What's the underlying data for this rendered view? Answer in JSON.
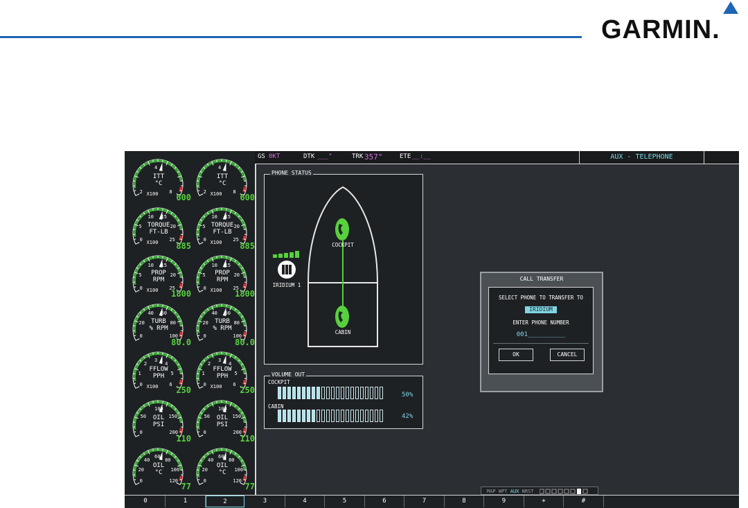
{
  "brand": {
    "logo_text": "GARMIN.",
    "rule_color": "#1f66b3",
    "triangle_color": "#1f66b3"
  },
  "topbar": {
    "gs_label": "GS",
    "gs_value": "0KT",
    "dtk_label": "DTK",
    "dtk_value": "___°",
    "trk_label": "TRK",
    "trk_value": "357°",
    "ete_label": "ETE",
    "ete_value": "__:__",
    "page_title": "AUX - TELEPHONE"
  },
  "gauges": [
    {
      "name": "itt-left",
      "label": "ITT",
      "unit": "°C",
      "scale": "X100",
      "value": "600",
      "ticks": [
        "2",
        "4",
        "8"
      ]
    },
    {
      "name": "itt-right",
      "label": "ITT",
      "unit": "°C",
      "scale": "X100",
      "value": "600",
      "ticks": [
        "2",
        "4",
        "8"
      ]
    },
    {
      "name": "torque-left",
      "label": "TORQUE",
      "unit": "FT-LB",
      "scale": "X100",
      "value": "885",
      "ticks": [
        "0",
        "5",
        "10",
        "15",
        "20",
        "25"
      ]
    },
    {
      "name": "torque-right",
      "label": "TORQUE",
      "unit": "FT-LB",
      "scale": "X100",
      "value": "885",
      "ticks": [
        "0",
        "5",
        "10",
        "15",
        "20",
        "25"
      ]
    },
    {
      "name": "prop-left",
      "label": "PROP",
      "unit": "RPM",
      "scale": "X100",
      "value": "1800",
      "ticks": [
        "0",
        "5",
        "10",
        "15",
        "20",
        "25"
      ]
    },
    {
      "name": "prop-right",
      "label": "PROP",
      "unit": "RPM",
      "scale": "X100",
      "value": "1800",
      "ticks": [
        "0",
        "5",
        "10",
        "15",
        "20",
        "25"
      ]
    },
    {
      "name": "turb-left",
      "label": "TURB",
      "unit": "% RPM",
      "scale": "",
      "value": "80.0",
      "ticks": [
        "0",
        "20",
        "40",
        "60",
        "80",
        "100"
      ]
    },
    {
      "name": "turb-right",
      "label": "TURB",
      "unit": "% RPM",
      "scale": "",
      "value": "80.0",
      "ticks": [
        "0",
        "20",
        "40",
        "60",
        "80",
        "100"
      ]
    },
    {
      "name": "fflow-left",
      "label": "FFLOW",
      "unit": "PPH",
      "scale": "X100",
      "value": "250",
      "ticks": [
        "0",
        "1",
        "2",
        "3",
        "4",
        "5",
        "6"
      ]
    },
    {
      "name": "fflow-right",
      "label": "FFLOW",
      "unit": "PPH",
      "scale": "X100",
      "value": "250",
      "ticks": [
        "0",
        "1",
        "2",
        "3",
        "4",
        "5",
        "6"
      ]
    },
    {
      "name": "oilpsi-left",
      "label": "OIL",
      "unit": "PSI",
      "scale": "",
      "value": "110",
      "ticks": [
        "0",
        "50",
        "100",
        "150",
        "200"
      ]
    },
    {
      "name": "oilpsi-right",
      "label": "OIL",
      "unit": "PSI",
      "scale": "",
      "value": "110",
      "ticks": [
        "0",
        "50",
        "100",
        "150",
        "200"
      ]
    },
    {
      "name": "oiltemp-left",
      "label": "OIL",
      "unit": "°C",
      "scale": "",
      "value": "77",
      "ticks": [
        "0",
        "20",
        "40",
        "60",
        "80",
        "100",
        "120"
      ]
    },
    {
      "name": "oiltemp-right",
      "label": "OIL",
      "unit": "°C",
      "scale": "",
      "value": "77",
      "ticks": [
        "0",
        "20",
        "40",
        "60",
        "80",
        "100",
        "120"
      ]
    }
  ],
  "phone_status": {
    "title": "PHONE STATUS",
    "cockpit_label": "COCKPIT",
    "cabin_label": "CABIN",
    "iridium_label": "IRIDIUM 1",
    "signal_bars": 5
  },
  "volume_out": {
    "title": "VOLUME OUT",
    "channels": [
      {
        "name": "COCKPIT",
        "percent_label": "50%",
        "level": 0.5
      },
      {
        "name": "CABIN",
        "percent_label": "42%",
        "level": 0.42
      }
    ]
  },
  "call_transfer": {
    "title": "CALL TRANSFER",
    "select_prompt": "SELECT PHONE TO TRANSFER TO",
    "selected_phone": "IRIDIUM",
    "number_prompt": "ENTER PHONE NUMBER",
    "number_value": "001__________",
    "ok_label": "OK",
    "cancel_label": "CANCEL"
  },
  "page_group": {
    "items": [
      "MAP",
      "WPT",
      "AUX",
      "NRST"
    ],
    "active": "AUX"
  },
  "softkeys": [
    "0",
    "1",
    "2",
    "3",
    "4",
    "5",
    "6",
    "7",
    "8",
    "9",
    "+",
    "#"
  ],
  "softkey_active": "2"
}
